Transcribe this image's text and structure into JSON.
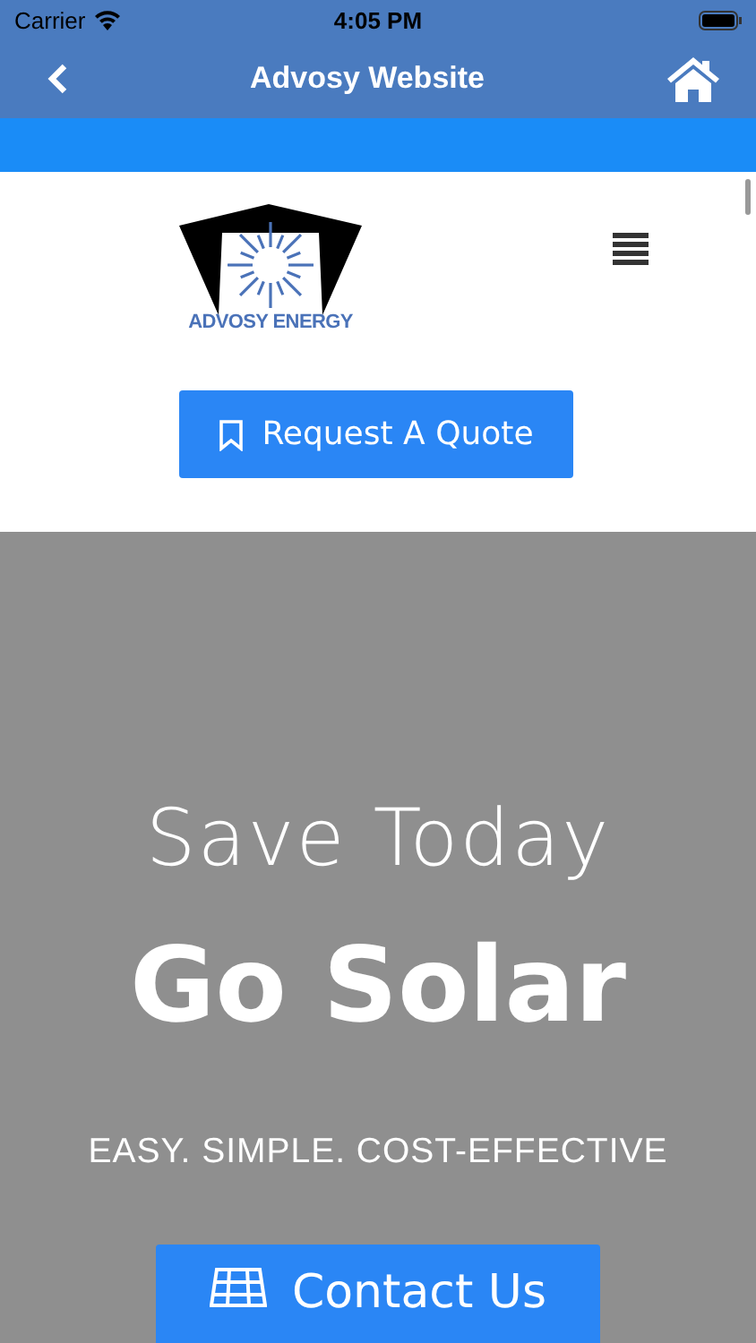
{
  "status_bar": {
    "carrier": "Carrier",
    "time": "4:05 PM"
  },
  "nav_bar": {
    "title": "Advosy Website"
  },
  "site_header": {
    "logo_text": "ADVOSY ENERGY",
    "quote_button": "Request A Quote"
  },
  "hero": {
    "kicker": "Save Today",
    "headline": "Go Solar",
    "tagline": "EASY. SIMPLE. COST-EFFECTIVE",
    "contact_button": "Contact Us"
  }
}
